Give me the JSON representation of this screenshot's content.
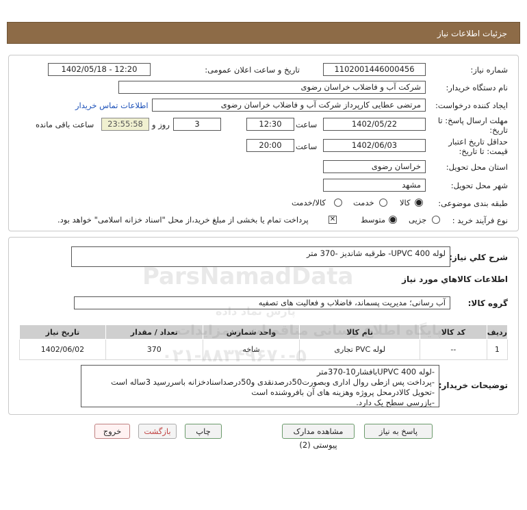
{
  "header": {
    "title": "جزئیات اطلاعات نیاز"
  },
  "form": {
    "need_number_label": "شماره نیاز:",
    "need_number": "1102001446000456",
    "announce_label": "تاریخ و ساعت اعلان عمومی:",
    "announce_value": "1402/05/18 - 12:20",
    "buyer_label": "نام دستگاه خریدار:",
    "buyer": "شرکت آب و فاضلاب خراسان رضوی",
    "creator_label": "ایجاد کننده درخواست:",
    "creator": "مرتضی عطایی کارپرداز شرکت آب و فاضلاب خراسان رضوی",
    "contact_link": "اطلاعات تماس خریدار",
    "deadline_label_1": "مهلت ارسال پاسخ: تا",
    "deadline_label_2": "تاریخ:",
    "deadline_date": "1402/05/22",
    "time_label": "ساعت",
    "deadline_time": "12:30",
    "days_value": "3",
    "days_label": "روز و",
    "remain_value": "23:55:58",
    "remain_label": "ساعت باقی مانده",
    "validity_label_1": "حداقل تاریخ اعتبار",
    "validity_label_2": "قیمت: تا تاریخ:",
    "validity_date": "1402/06/03",
    "validity_time_label": "ساعت",
    "validity_time": "20:00",
    "province_label": "استان محل تحویل:",
    "province": "خراسان رضوی",
    "city_label": "شهر محل تحویل:",
    "city": "مشهد",
    "category_label": "طبقه بندی موضوعی:",
    "category_options": [
      "کالا",
      "خدمت",
      "کالا/خدمت"
    ],
    "category_selected": "کالا",
    "process_label": "نوع فرآیند خرید :",
    "process_options": [
      "جزیی",
      "متوسط"
    ],
    "process_selected": "متوسط",
    "payment_note": "پرداخت تمام یا بخشی از مبلغ خرید،از محل \"اسناد خزانه اسلامی\" خواهد بود."
  },
  "summary": {
    "label": "شرح کلي نياز:",
    "value": "لوله UPVC 400- طرقبه شاندیز -370 متر"
  },
  "goods": {
    "section_title": "اطلاعات کالاهاي مورد نياز",
    "group_label": "گروه کالا:",
    "group_value": "آب رسانی؛ مدیریت پسماند، فاضلاب و فعالیت های تصفیه",
    "columns": [
      "ردیف",
      "کد کالا",
      "نام کالا",
      "واحد شمارش",
      "تعداد / مقدار",
      "تاریخ نیاز"
    ],
    "rows": [
      [
        "1",
        "--",
        "لوله PVC تجاری",
        "شاخه",
        "370",
        "1402/06/02"
      ]
    ]
  },
  "buyer_notes": {
    "label": "توضیحات خریدار:",
    "lines": [
      "-لوله UPVC 400بافشار10-370متر",
      "-پرداخت پس ازطی روال اداری وبصورت50درصدنقدی و50درصداسنادخزانه باسررسید 3ساله است",
      "-تحویل کالادرمحل پروژه وهزینه های آن بافروشنده است",
      "-بازرسی سطح یک دارد."
    ]
  },
  "buttons": {
    "reply": "پاسخ به نیاز",
    "view_docs": "مشاهده مدارک پیوستی (2)",
    "print": "چاپ",
    "back": "بازگشت",
    "exit": "خروج"
  },
  "watermark": {
    "brand": "ParsNamadData",
    "line1": "پایگاه اطلاع رسانی مناقصات و مزایدات",
    "line2": "پارس نماد داده",
    "phone": "۰۲۱-۸۸۳۴۹۶۷۰-۵"
  }
}
